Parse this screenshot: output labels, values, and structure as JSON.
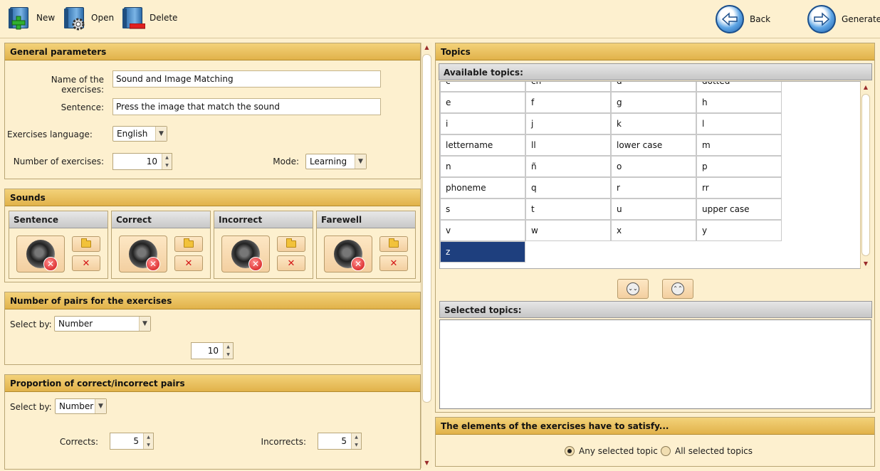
{
  "toolbar": {
    "new_label": "New",
    "open_label": "Open",
    "delete_label": "Delete",
    "back_label": "Back",
    "generate_label": "Generate"
  },
  "general": {
    "title": "General parameters",
    "name_label": "Name of the exercises:",
    "name_value": "Sound and Image Matching",
    "sentence_label": "Sentence:",
    "sentence_value": "Press the image that match the sound",
    "language_label": "Exercises language:",
    "language_value": "English",
    "number_label": "Number of exercises:",
    "number_value": "10",
    "mode_label": "Mode:",
    "mode_value": "Learning"
  },
  "sounds": {
    "title": "Sounds",
    "items": [
      "Sentence",
      "Correct",
      "Incorrect",
      "Farewell"
    ]
  },
  "pairs": {
    "title": "Number of pairs for the exercises",
    "select_label": "Select by:",
    "select_value": "Number",
    "count_value": "10"
  },
  "proportion": {
    "title": "Proportion of correct/incorrect pairs",
    "select_label": "Select by:",
    "select_value": "Number",
    "corrects_label": "Corrects:",
    "corrects_value": "5",
    "incorrects_label": "Incorrects:",
    "incorrects_value": "5"
  },
  "topics": {
    "title": "Topics",
    "available_label": "Available topics:",
    "selected_label": "Selected topics:",
    "rows": [
      [
        "c",
        "ch",
        "d",
        "dotted"
      ],
      [
        "e",
        "f",
        "g",
        "h"
      ],
      [
        "i",
        "j",
        "k",
        "l"
      ],
      [
        "lettername",
        "ll",
        "lower case",
        "m"
      ],
      [
        "n",
        "ñ",
        "o",
        "p"
      ],
      [
        "phoneme",
        "q",
        "r",
        "rr"
      ],
      [
        "s",
        "t",
        "u",
        "upper case"
      ],
      [
        "v",
        "w",
        "x",
        "y"
      ],
      [
        "z"
      ]
    ],
    "selected_cell": "z"
  },
  "satisfy": {
    "title": "The elements of the exercises have to satisfy...",
    "option_any": "Any selected topic",
    "option_all": "All selected topics",
    "selected": "any"
  }
}
